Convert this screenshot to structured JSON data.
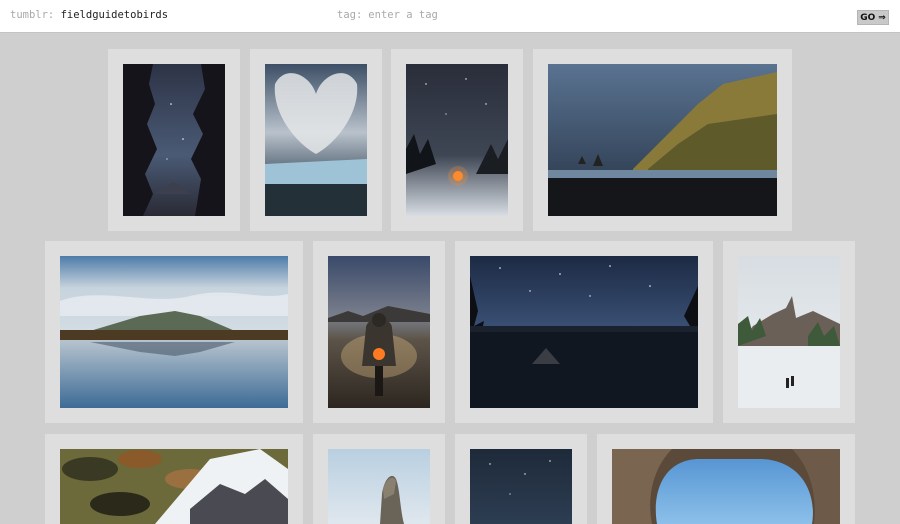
{
  "header": {
    "prefix": "tumblr:",
    "blog_name": "fieldguidetobirds",
    "tag_label": "tag:",
    "tag_placeholder": "enter a tag",
    "go_label": "GO",
    "go_arrow": "⇒"
  },
  "photos": [
    {
      "name": "photo-forest-night-sky",
      "subject": "night sky between pine silhouettes"
    },
    {
      "name": "photo-glacier-clouds",
      "subject": "glacier under heart-shaped clouds"
    },
    {
      "name": "photo-campfire-stars",
      "subject": "campfire under starry sky"
    },
    {
      "name": "photo-coastal-cliffs",
      "subject": "sea cliffs and black sand beach"
    },
    {
      "name": "photo-mountain-lake-reflection",
      "subject": "mountain reflected in calm lake"
    },
    {
      "name": "photo-motorcycle-rider",
      "subject": "rider on motorcycle at dusk"
    },
    {
      "name": "photo-starry-lake-canoe",
      "subject": "starry lake with canoe"
    },
    {
      "name": "photo-snowy-peak-hikers",
      "subject": "hikers in snow below a peak"
    },
    {
      "name": "photo-camo-tent",
      "subject": "camouflage tent and mountain"
    },
    {
      "name": "photo-rock-spire",
      "subject": "rock spire against sky"
    },
    {
      "name": "photo-night-sky",
      "subject": "night sky"
    },
    {
      "name": "photo-rock-arch",
      "subject": "rock arch with blue sky"
    }
  ]
}
